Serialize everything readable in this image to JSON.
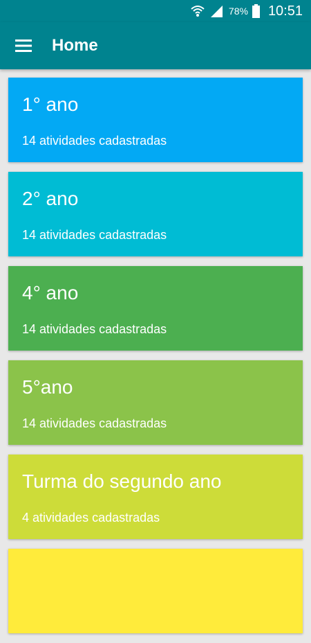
{
  "status_bar": {
    "battery": "78%",
    "time": "10:51"
  },
  "app_bar": {
    "title": "Home"
  },
  "cards": [
    {
      "title": "1° ano",
      "subtitle": "14 atividades cadastradas",
      "color": "#03a9f4"
    },
    {
      "title": "2° ano",
      "subtitle": "14 atividades cadastradas",
      "color": "#00bcd4"
    },
    {
      "title": "4° ano",
      "subtitle": "14 atividades cadastradas",
      "color": "#4caf50"
    },
    {
      "title": "5°ano",
      "subtitle": "14 atividades cadastradas",
      "color": "#8bc34a"
    },
    {
      "title": "Turma do segundo ano",
      "subtitle": "4 atividades cadastradas",
      "color": "#cddc39"
    },
    {
      "title": "",
      "subtitle": "",
      "color": "#ffeb3b"
    }
  ],
  "icons": {
    "menu": "menu-icon",
    "wifi": "wifi-icon",
    "signal": "signal-icon",
    "battery": "battery-icon"
  }
}
